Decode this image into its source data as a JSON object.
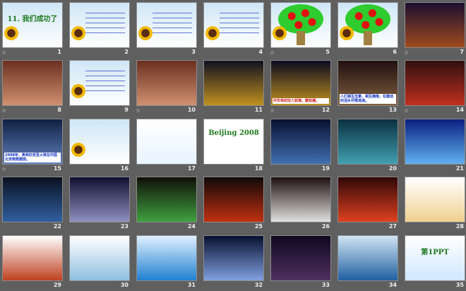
{
  "slides": [
    {
      "n": "1",
      "star": true,
      "title": "11. 我们成功了",
      "colors": [
        "#cfe6f6",
        "#ffffff"
      ],
      "kind": "light"
    },
    {
      "n": "2",
      "star": false,
      "colors": [
        "#cfe6f6",
        "#ffffff"
      ],
      "kind": "text"
    },
    {
      "n": "3",
      "star": false,
      "colors": [
        "#cfe6f6",
        "#ffffff"
      ],
      "kind": "text"
    },
    {
      "n": "4",
      "star": false,
      "colors": [
        "#cfe6f6",
        "#ffffff"
      ],
      "kind": "text"
    },
    {
      "n": "5",
      "star": true,
      "colors": [
        "#cfe6f6",
        "#ffffff"
      ],
      "kind": "tree"
    },
    {
      "n": "6",
      "star": false,
      "colors": [
        "#cfe6f6",
        "#ffffff"
      ],
      "kind": "tree"
    },
    {
      "n": "7",
      "star": true,
      "colors": [
        "#1a1030",
        "#a04a20"
      ],
      "kind": "photo"
    },
    {
      "n": "8",
      "star": true,
      "colors": [
        "#6a3020",
        "#d09070"
      ],
      "kind": "photo"
    },
    {
      "n": "9",
      "star": false,
      "colors": [
        "#cfe6f6",
        "#ffffff"
      ],
      "kind": "text"
    },
    {
      "n": "10",
      "star": true,
      "colors": [
        "#6a3020",
        "#d09070"
      ],
      "kind": "photo"
    },
    {
      "n": "11",
      "star": false,
      "colors": [
        "#101020",
        "#c09020"
      ],
      "kind": "photo"
    },
    {
      "n": "12",
      "star": true,
      "caption": "中华世纪坛人如海，歌如潮。",
      "red": true,
      "colors": [
        "#0a0a20",
        "#c09020"
      ],
      "kind": "photo"
    },
    {
      "n": "13",
      "star": false,
      "caption": "人们相互击掌，相互拥抱，任激动的泪水尽情流淌。",
      "colors": [
        "#201010",
        "#806040"
      ],
      "kind": "photo"
    },
    {
      "n": "14",
      "star": true,
      "colors": [
        "#301010",
        "#c03020"
      ],
      "kind": "photo"
    },
    {
      "n": "15",
      "star": true,
      "caption": "2008年，奥林匹克圣火将在中国北京熊熊燃烧。",
      "colors": [
        "#102040",
        "#6080c0"
      ],
      "kind": "photo"
    },
    {
      "n": "16",
      "star": false,
      "colors": [
        "#cfe6f6",
        "#ffffff"
      ],
      "kind": "light"
    },
    {
      "n": "17",
      "star": false,
      "colors": [
        "#ffffff",
        "#e8f4ff"
      ],
      "kind": "plain"
    },
    {
      "n": "18",
      "star": false,
      "title": "Beijing 2008",
      "colors": [
        "#ffffff",
        "#ffffff"
      ],
      "kind": "plain"
    },
    {
      "n": "19",
      "star": false,
      "colors": [
        "#0a1030",
        "#4070b0"
      ],
      "kind": "photo"
    },
    {
      "n": "20",
      "star": false,
      "colors": [
        "#0a3040",
        "#40a0b0"
      ],
      "kind": "photo"
    },
    {
      "n": "21",
      "star": false,
      "colors": [
        "#0a2080",
        "#60b0f0"
      ],
      "kind": "photo"
    },
    {
      "n": "22",
      "star": false,
      "colors": [
        "#0a1020",
        "#3060a0"
      ],
      "kind": "photo"
    },
    {
      "n": "23",
      "star": false,
      "colors": [
        "#101030",
        "#9090c0"
      ],
      "kind": "photo"
    },
    {
      "n": "24",
      "star": false,
      "colors": [
        "#101008",
        "#40a040"
      ],
      "kind": "photo"
    },
    {
      "n": "25",
      "star": false,
      "colors": [
        "#100808",
        "#c03010"
      ],
      "kind": "photo"
    },
    {
      "n": "26",
      "star": false,
      "colors": [
        "#201010",
        "#e0e0e0"
      ],
      "kind": "photo"
    },
    {
      "n": "27",
      "star": false,
      "colors": [
        "#300808",
        "#e04020"
      ],
      "kind": "photo"
    },
    {
      "n": "28",
      "star": false,
      "colors": [
        "#ffffff",
        "#f0d090"
      ],
      "kind": "plain"
    },
    {
      "n": "29",
      "star": false,
      "colors": [
        "#ffffff",
        "#c04020"
      ],
      "kind": "plain"
    },
    {
      "n": "30",
      "star": false,
      "colors": [
        "#ffffff",
        "#90c0e0"
      ],
      "kind": "plain"
    },
    {
      "n": "31",
      "star": false,
      "colors": [
        "#e0f0ff",
        "#2080d0"
      ],
      "kind": "plain"
    },
    {
      "n": "32",
      "star": false,
      "colors": [
        "#081030",
        "#80a0e0"
      ],
      "kind": "photo"
    },
    {
      "n": "33",
      "star": false,
      "colors": [
        "#100820",
        "#503060"
      ],
      "kind": "photo"
    },
    {
      "n": "34",
      "star": false,
      "colors": [
        "#d0e4f4",
        "#2060a0"
      ],
      "kind": "plain"
    },
    {
      "n": "35",
      "star": false,
      "title": "第1PPT",
      "colors": [
        "#ffffff",
        "#d0e8ff"
      ],
      "kind": "plain"
    }
  ],
  "star_icon": "☆"
}
